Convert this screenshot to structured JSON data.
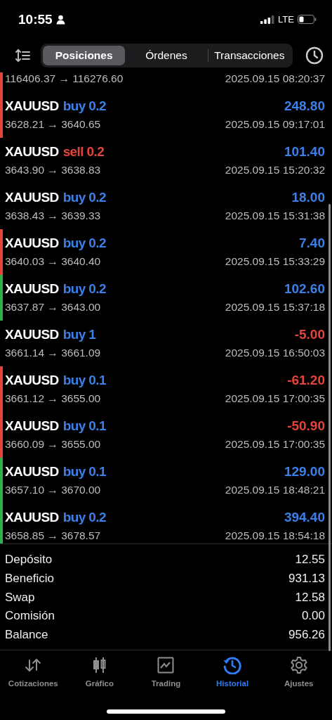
{
  "status_bar": {
    "time": "10:55",
    "network": "LTE"
  },
  "segments": [
    {
      "label": "Posiciones",
      "selected": true
    },
    {
      "label": "Órdenes",
      "selected": false
    },
    {
      "label": "Transacciones",
      "selected": false
    }
  ],
  "deals": [
    {
      "partial": true,
      "color": "#e5443a",
      "prices": "116406.37 → 116276.60",
      "time": "2025.09.15 08:20:37"
    },
    {
      "symbol": "XAUUSD",
      "kind": "buy",
      "volume": "buy 0.2",
      "profit": "248.80",
      "negative": false,
      "color": "#e5443a",
      "prices": "3628.21 → 3640.65",
      "time": "2025.09.15 09:17:01"
    },
    {
      "symbol": "XAUUSD",
      "kind": "sell",
      "volume": "sell 0.2",
      "profit": "101.40",
      "negative": false,
      "prices": "3643.90 → 3638.83",
      "time": "2025.09.15 15:20:32"
    },
    {
      "symbol": "XAUUSD",
      "kind": "buy",
      "volume": "buy 0.2",
      "profit": "18.00",
      "negative": false,
      "prices": "3638.43 → 3639.33",
      "time": "2025.09.15 15:31:38"
    },
    {
      "symbol": "XAUUSD",
      "kind": "buy",
      "volume": "buy 0.2",
      "profit": "7.40",
      "negative": false,
      "color": "#e5443a",
      "prices": "3640.03 → 3640.40",
      "time": "2025.09.15 15:33:29"
    },
    {
      "symbol": "XAUUSD",
      "kind": "buy",
      "volume": "buy 0.2",
      "profit": "102.60",
      "negative": false,
      "color": "#2fb04a",
      "prices": "3637.87 → 3643.00",
      "time": "2025.09.15 15:37:18"
    },
    {
      "symbol": "XAUUSD",
      "kind": "buy",
      "volume": "buy 1",
      "profit": "-5.00",
      "negative": true,
      "prices": "3661.14 → 3661.09",
      "time": "2025.09.15 16:50:03"
    },
    {
      "symbol": "XAUUSD",
      "kind": "buy",
      "volume": "buy 0.1",
      "profit": "-61.20",
      "negative": true,
      "color": "#e5443a",
      "prices": "3661.12 → 3655.00",
      "time": "2025.09.15 17:00:35"
    },
    {
      "symbol": "XAUUSD",
      "kind": "buy",
      "volume": "buy 0.1",
      "profit": "-50.90",
      "negative": true,
      "color": "#e5443a",
      "prices": "3660.09 → 3655.00",
      "time": "2025.09.15 17:00:35"
    },
    {
      "symbol": "XAUUSD",
      "kind": "buy",
      "volume": "buy 0.1",
      "profit": "129.00",
      "negative": false,
      "color": "#2fb04a",
      "prices": "3657.10 → 3670.00",
      "time": "2025.09.15 18:48:21"
    },
    {
      "symbol": "XAUUSD",
      "kind": "buy",
      "volume": "buy 0.2",
      "profit": "394.40",
      "negative": false,
      "color": "#2fb04a",
      "prices": "3658.85 → 3678.57",
      "time": "2025.09.15 18:54:18"
    }
  ],
  "summary": [
    {
      "label": "Depósito",
      "value": "12.55"
    },
    {
      "label": "Beneficio",
      "value": "931.13"
    },
    {
      "label": "Swap",
      "value": "12.58"
    },
    {
      "label": "Comisión",
      "value": "0.00"
    },
    {
      "label": "Balance",
      "value": "956.26"
    }
  ],
  "tab_bar": [
    {
      "label": "Cotizaciones",
      "kind": "quotes",
      "selected": false
    },
    {
      "label": "Gráfico",
      "kind": "chart",
      "selected": false
    },
    {
      "label": "Trading",
      "kind": "trading",
      "selected": false
    },
    {
      "label": "Historial",
      "kind": "history",
      "selected": true
    },
    {
      "label": "Ajustes",
      "kind": "settings",
      "selected": false
    }
  ]
}
